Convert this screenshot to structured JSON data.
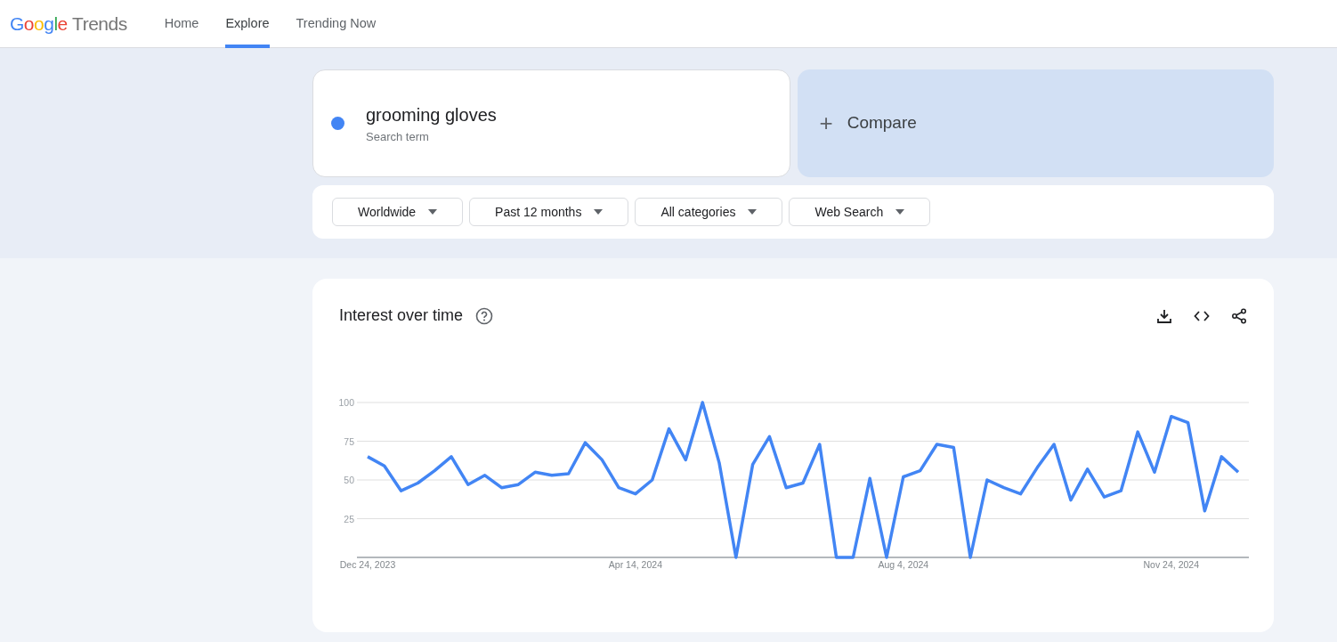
{
  "header": {
    "logo_google": "Google",
    "logo_trends": "Trends",
    "nav": [
      {
        "label": "Home",
        "selected": false
      },
      {
        "label": "Explore",
        "selected": true
      },
      {
        "label": "Trending Now",
        "selected": false
      }
    ]
  },
  "search": {
    "term": "grooming gloves",
    "subtitle": "Search term",
    "color": "#4285f4",
    "compare_icon": "+",
    "compare": "Compare"
  },
  "filters": [
    "Worldwide",
    "Past 12 months",
    "All categories",
    "Web Search"
  ],
  "interest": {
    "title": "Interest over time",
    "chart_data": {
      "type": "line",
      "categories": [
        "Dec 24, 2023",
        null,
        null,
        null,
        null,
        null,
        null,
        null,
        null,
        null,
        null,
        null,
        null,
        null,
        null,
        null,
        "Apr 14, 2024",
        null,
        null,
        null,
        null,
        null,
        null,
        null,
        null,
        null,
        null,
        null,
        null,
        null,
        null,
        null,
        "Aug 4, 2024",
        null,
        null,
        null,
        null,
        null,
        null,
        null,
        null,
        null,
        null,
        null,
        null,
        null,
        null,
        null,
        "Nov 24, 2024",
        null,
        null,
        null,
        null
      ],
      "series": [
        {
          "color": "#4285f4",
          "values": [
            65,
            59,
            43,
            48,
            56,
            65,
            47,
            53,
            45,
            47,
            55,
            53,
            54,
            74,
            63,
            45,
            41,
            50,
            83,
            63,
            100,
            61,
            0,
            60,
            78,
            45,
            48,
            73,
            0,
            0,
            51,
            0,
            52,
            56,
            73,
            71,
            0,
            50,
            45,
            41,
            58,
            73,
            37,
            57,
            39,
            43,
            81,
            55,
            91,
            87,
            30,
            65,
            55
          ]
        }
      ],
      "ylim": [
        0,
        100
      ],
      "yticks": [
        25,
        50,
        75,
        100
      ],
      "grid": true
    }
  }
}
